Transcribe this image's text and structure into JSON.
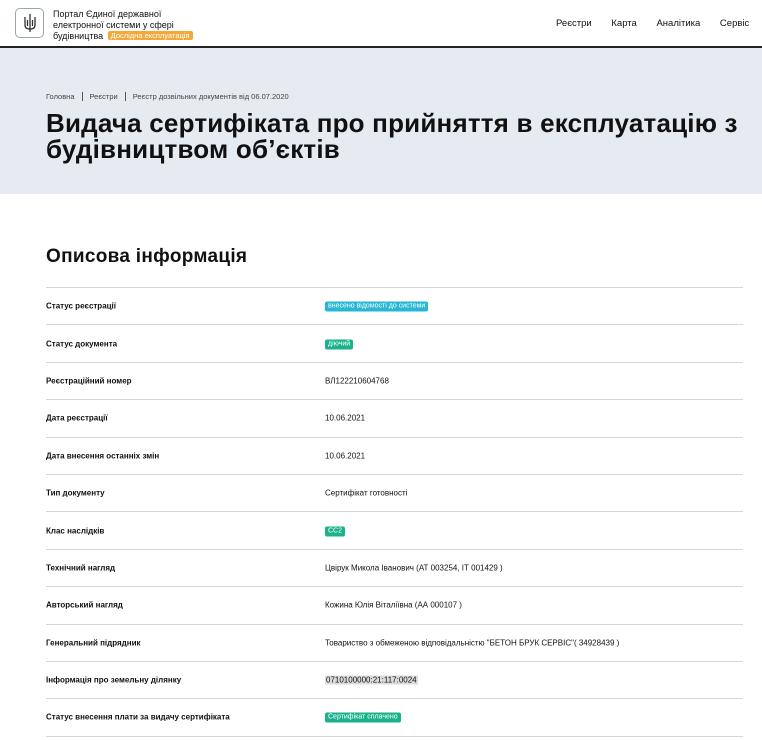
{
  "header": {
    "portal_title": "Портал Єдиної державної електронної системи у сфері будівництва",
    "beta_badge": "Дослідна експлуатація",
    "logo_icon": "trident-icon",
    "nav": [
      "Реєстри",
      "Карта",
      "Аналітика",
      "Сервіс"
    ]
  },
  "breadcrumb": [
    "Головна",
    "Реєстри",
    "Реєстр дозвільних документів від 06.07.2020"
  ],
  "page_title_line1": "Видача сертифіката про прийняття в експлуатацію з",
  "page_title_line2": "будівництвом об’єктів",
  "section_title": "Описова інформація",
  "rows": [
    {
      "label": "Статус реєстрації",
      "value": "внесено відомості до системи",
      "pill_color": "#27b6d4"
    },
    {
      "label": "Статус документа",
      "value": "діючий",
      "pill_color": "#1ab28c"
    },
    {
      "label": "Реєстраційний номер",
      "value": "ВЛ122210604768"
    },
    {
      "label": "Дата реєстрації",
      "value": "10.06.2021"
    },
    {
      "label": "Дата внесення останніх змін",
      "value": "10.06.2021"
    },
    {
      "label": "Тип документу",
      "value": "Сертифікат готовності"
    },
    {
      "label": "Клас наслідків",
      "value": "СС2",
      "pill_color": "#1ab28c"
    },
    {
      "label": "Технічний нагляд",
      "value": "Цвірук Микола Іванович (АТ 003254, ІТ 001429 )"
    },
    {
      "label": "Авторський нагляд",
      "value": "Кожина Юлія Віталіївна (АА 000107 )"
    },
    {
      "label": "Генеральний підрядник",
      "value": "Товариство з обмеженою відповідальністю \"БЕТОН БРУК СЕРВІС\"( 34928439 )"
    },
    {
      "label": "Інформація про земельну ділянку",
      "value": "0710100000:21:117:0024"
    },
    {
      "label": "Статус внесення плати за видачу сертифіката",
      "value": "Сертифікат сплачено",
      "pill_color": "#1ab28c"
    }
  ]
}
